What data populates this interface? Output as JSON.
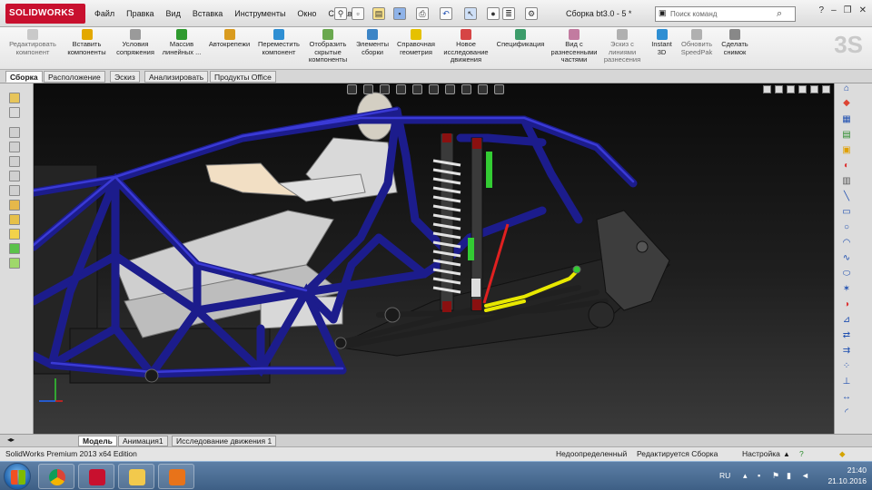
{
  "app": {
    "logo_text": "SOLIDWORKS",
    "document_title": "Сборка bt3.0 - 5 *",
    "search_placeholder": "Поиск команд"
  },
  "menu": [
    "Файл",
    "Правка",
    "Вид",
    "Вставка",
    "Инструменты",
    "Окно",
    "Справка"
  ],
  "ribbon": [
    {
      "label": "Редактировать\nкомпонент",
      "icon": "edit-component-icon",
      "color": "#c9c9c9",
      "dim": true
    },
    {
      "label": "Вставить\nкомпоненты",
      "icon": "insert-components-icon",
      "color": "#e3a800",
      "dim": false
    },
    {
      "label": "Условия\nсопряжения",
      "icon": "mate-icon",
      "color": "#9a9a9a",
      "dim": false
    },
    {
      "label": "Массив\nлинейных ...",
      "icon": "linear-pattern-icon",
      "color": "#2f9a2f",
      "dim": false
    },
    {
      "label": "Автокрепежи",
      "icon": "smart-fasteners-icon",
      "color": "#d99b1f",
      "dim": false
    },
    {
      "label": "Переместить\nкомпонент",
      "icon": "move-component-icon",
      "color": "#2f8fd3",
      "dim": false
    },
    {
      "label": "Отобразить\nскрытые\nкомпоненты",
      "icon": "show-hidden-icon",
      "color": "#6aa84f",
      "dim": false
    },
    {
      "label": "Элементы\nсборки",
      "icon": "assembly-features-icon",
      "color": "#3d85c6",
      "dim": false
    },
    {
      "label": "Справочная\nгеометрия",
      "icon": "reference-geometry-icon",
      "color": "#e5c100",
      "dim": false
    },
    {
      "label": "Новое\nисследование\nдвижения",
      "icon": "motion-study-icon",
      "color": "#d64545",
      "dim": false
    },
    {
      "label": "Спецификация",
      "icon": "bom-icon",
      "color": "#3c9c6a",
      "dim": false
    },
    {
      "label": "Вид с\nразнесенными\nчастями",
      "icon": "exploded-view-icon",
      "color": "#c27ba0",
      "dim": false
    },
    {
      "label": "Эскиз с\nлиниями\nразнесения",
      "icon": "explode-line-sketch-icon",
      "color": "#b0b0b0",
      "dim": true
    },
    {
      "label": "Instant\n3D",
      "icon": "instant3d-icon",
      "color": "#2f8fd3",
      "dim": false
    },
    {
      "label": "Обновить\nSpeedPak",
      "icon": "speedpak-icon",
      "color": "#b0b0b0",
      "dim": true
    },
    {
      "label": "Сделать\nснимок",
      "icon": "snapshot-icon",
      "color": "#888888",
      "dim": false
    }
  ],
  "tabs": [
    "Сборка",
    "Расположение",
    "Эскиз",
    "Анализировать",
    "Продукты Office"
  ],
  "active_tab": "Сборка",
  "model_tabs": [
    "Модель",
    "Анимация1",
    "Исследование движения 1"
  ],
  "active_model_tab": "Модель",
  "status": {
    "product": "SolidWorks Premium 2013 x64 Edition",
    "definition": "Недоопределенный",
    "edit_state": "Редактируется Сборка",
    "customize": "Настройка"
  },
  "taskbar": {
    "lang": "RU",
    "time": "21:40",
    "date": "21.10.2016",
    "apps": [
      "chrome-icon",
      "solidworks-icon",
      "file-explorer-icon",
      "app-icon"
    ]
  },
  "colors": {
    "frame_tube": "#1c1c8c",
    "frame_highlight": "#3a3ad6",
    "shock_spring": "#d8d8d8",
    "shock_body": "#8a1010",
    "green_part": "#33cc33",
    "yellow_arm": "#e8e800",
    "red_rod": "#e02020"
  }
}
